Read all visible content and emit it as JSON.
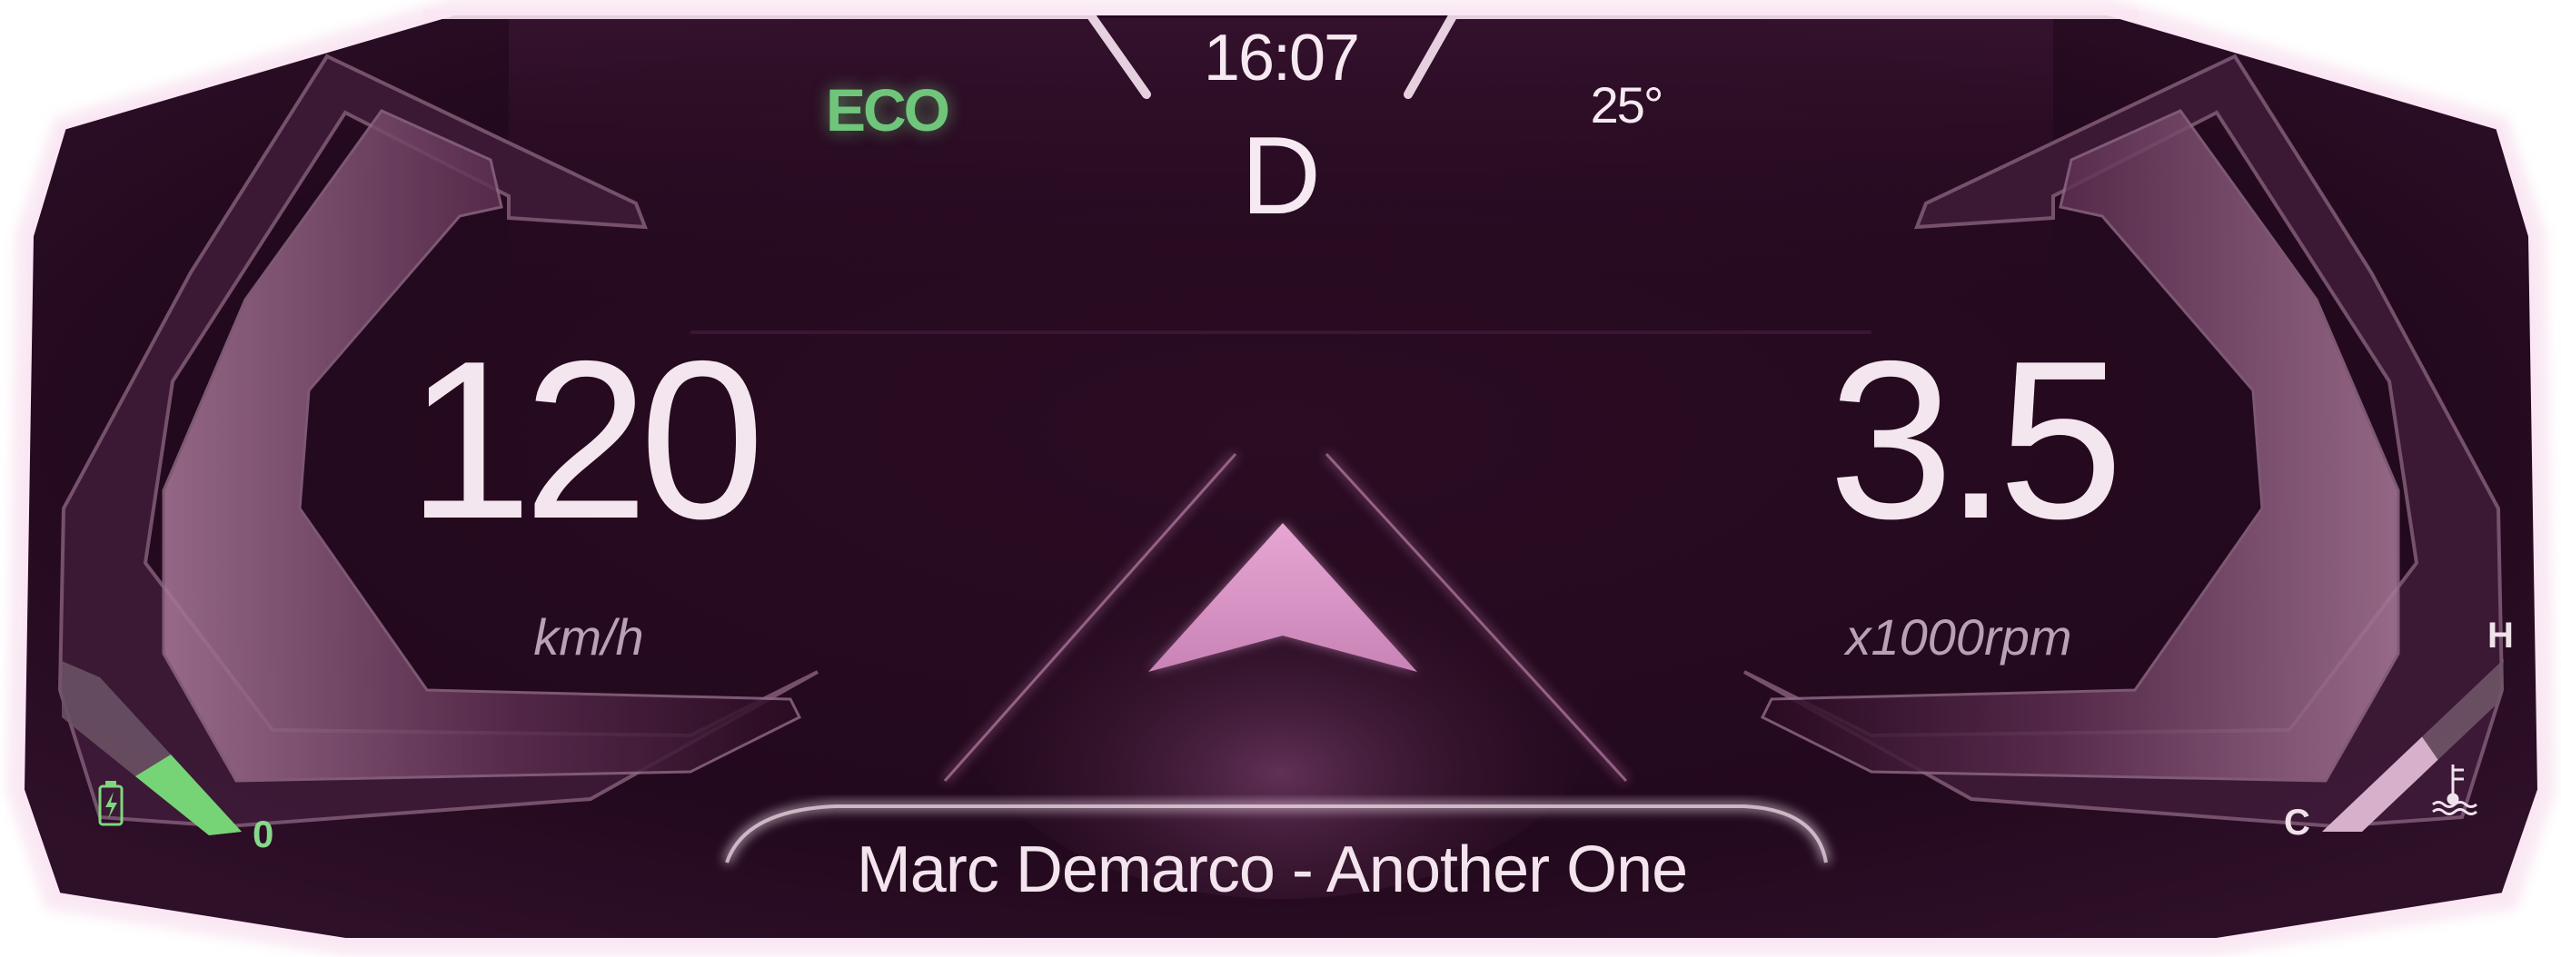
{
  "header": {
    "clock": "16:07",
    "gear": "D",
    "drive_mode": "ECO",
    "outside_temperature": "25°"
  },
  "speedometer": {
    "value": "120",
    "unit": "km/h"
  },
  "tachometer": {
    "value": "3.5",
    "unit": "x1000rpm"
  },
  "media": {
    "now_playing": "Marc Demarco - Another One"
  },
  "battery_gauge": {
    "value_label": "0",
    "icon": "battery-charging-icon",
    "level_fraction": 0.5
  },
  "coolant_gauge": {
    "high_label": "H",
    "low_label": "C",
    "icon": "coolant-temperature-icon",
    "level_fraction": 0.55
  },
  "navigation": {
    "icon": "navigation-arrow-icon"
  },
  "colors": {
    "background": "#230a1d",
    "bezel": "#fbe6f3",
    "accent_pink": "#d98fc1",
    "eco_green": "#6fc67a",
    "text": "#f6e9f1"
  }
}
